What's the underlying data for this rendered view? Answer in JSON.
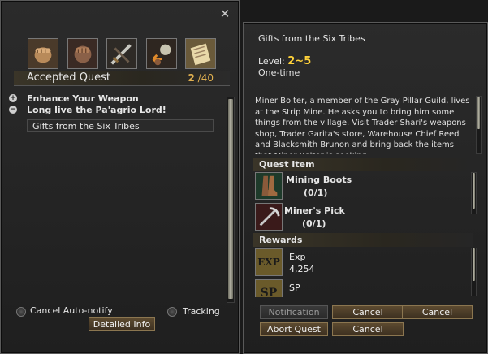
{
  "quest_window": {
    "close_glyph": "✕",
    "tabs": [
      "fist-icon",
      "fist-icon",
      "sword-icon",
      "arrows-icon",
      "scroll-icon"
    ],
    "header": {
      "title": "Accepted Quest",
      "current": "2",
      "separator": "/",
      "max": "40"
    },
    "quests": [
      {
        "sign": "+",
        "label": "Enhance Your Weapon"
      },
      {
        "sign": "−",
        "label": "Long live the Pa'agrio Lord!"
      }
    ],
    "selected_quest": "Gifts from the Six Tribes",
    "cancel_auto_notify": "Cancel Auto-notify",
    "tracking": "Tracking",
    "detailed_info": "Detailed Info"
  },
  "detail": {
    "title": "Gifts from the Six Tribes",
    "level_label": "Level:",
    "level_value": "2~5",
    "repeat": "One-time",
    "description": "Miner Bolter, a member of the Gray Pillar Guild, lives at the Strip Mine. He asks you to bring him some things from the village. Visit Trader Shari's weapons shop, Trader Garita's store, Warehouse Chief Reed and Blacksmith Brunon and bring back the items that Miner Bolter is seeking.",
    "quest_item_header": "Quest Item",
    "items": [
      {
        "name": "Mining Boots",
        "progress": "(0/1)",
        "icon": "boots-icon"
      },
      {
        "name": "Miner's Pick",
        "progress": "(0/1)",
        "icon": "pick-icon"
      }
    ],
    "rewards_header": "Rewards",
    "rewards": [
      {
        "icon_text": "EXP",
        "name": "Exp",
        "value": "4,254"
      },
      {
        "icon_text": "SP",
        "name": "SP",
        "value": ""
      }
    ],
    "buttons": {
      "notification": "Notification",
      "cancel1": "Cancel",
      "cancel2": "Cancel",
      "abort": "Abort Quest",
      "cancel3": "Cancel"
    }
  },
  "colors": {
    "level": "#ffd23a",
    "count": "#e0b050",
    "button_border": "#8b7650"
  }
}
